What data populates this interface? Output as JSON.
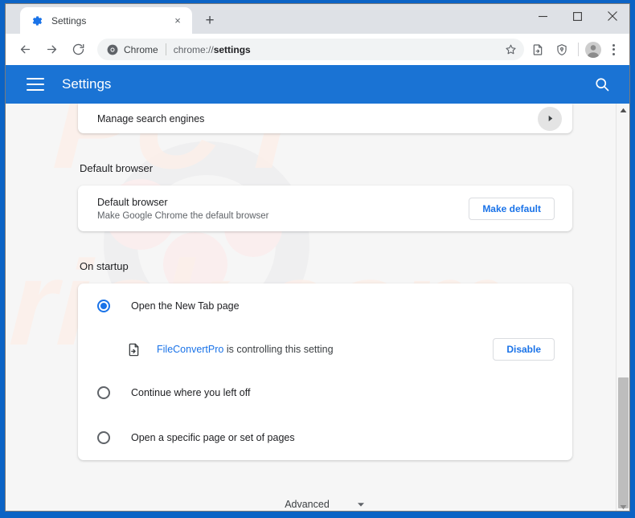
{
  "window": {
    "controls": {
      "minimize": "minimize-icon",
      "maximize": "maximize-icon",
      "close": "close-icon"
    }
  },
  "tabstrip": {
    "tab": {
      "title": "Settings",
      "favicon": "gear-icon",
      "close_label": "×"
    },
    "new_tab_label": "+"
  },
  "toolbar": {
    "back": "back-arrow-icon",
    "forward": "forward-arrow-icon",
    "reload": "reload-icon",
    "site_chip_label": "Chrome",
    "url_prefix": "chrome://",
    "url_bold": "settings",
    "star": "star-icon",
    "share": "share-icon",
    "shield": "shield-icon",
    "avatar": "avatar-icon",
    "menu": "three-dot-menu-icon"
  },
  "settings_header": {
    "menu_icon": "hamburger-icon",
    "title": "Settings",
    "search_icon": "search-icon"
  },
  "content": {
    "search_engines_row": {
      "label": "Manage search engines",
      "arrow": "chevron-right-icon"
    },
    "default_browser": {
      "section_title": "Default browser",
      "row_title": "Default browser",
      "row_subtitle": "Make Google Chrome the default browser",
      "button_label": "Make default"
    },
    "on_startup": {
      "section_title": "On startup",
      "options": [
        {
          "label": "Open the New Tab page",
          "checked": true
        },
        {
          "label": "Continue where you left off",
          "checked": false
        },
        {
          "label": "Open a specific page or set of pages",
          "checked": false
        }
      ],
      "extension_notice": {
        "icon": "file-arrow-icon",
        "name": "FileConvertPro",
        "text": " is controlling this setting",
        "button_label": "Disable"
      }
    },
    "advanced": {
      "label": "Advanced",
      "chevron": "chevron-down-icon"
    }
  },
  "scrollbar": {
    "up": "scroll-up-arrow-icon",
    "down": "scroll-down-arrow-icon"
  },
  "watermark": {
    "text": "pcrisk.com"
  },
  "colors": {
    "chrome_blue": "#1a73d4",
    "accent_blue": "#1a73e8",
    "window_frame": "#0b63c5",
    "tabstrip": "#dee1e6",
    "content_bg": "#f6f6f6"
  }
}
